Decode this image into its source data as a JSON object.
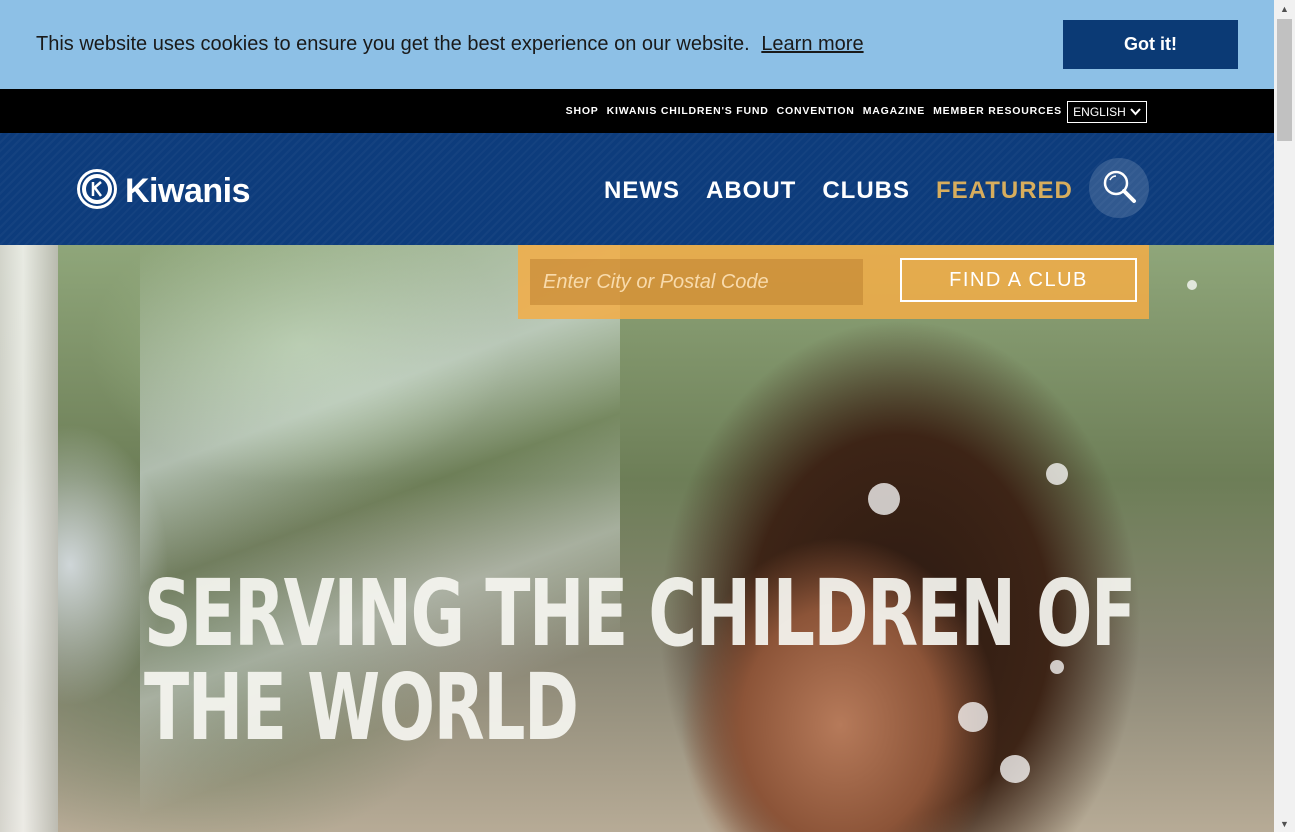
{
  "cookie": {
    "message": "This website uses cookies to ensure you get the best experience on our website.",
    "learn_more": "Learn more",
    "accept": "Got it!"
  },
  "utility": {
    "links": [
      "SHOP",
      "KIWANIS CHILDREN'S FUND",
      "CONVENTION",
      "MAGAZINE",
      "MEMBER RESOURCES"
    ],
    "language": "ENGLISH"
  },
  "header": {
    "logo_text": "Kiwanis",
    "nav": [
      "NEWS",
      "ABOUT",
      "CLUBS",
      "FEATURED"
    ],
    "search_icon": "search-icon"
  },
  "find_club": {
    "placeholder": "Enter City or Postal Code",
    "button": "FIND A CLUB"
  },
  "hero": {
    "title_line1": "SERVING THE CHILDREN OF",
    "title_line2": "THE WORLD"
  },
  "colors": {
    "cookie_bg": "#8dc0e6",
    "cookie_button": "#0b3a75",
    "header_bg": "#0d3c7c",
    "featured": "#d7ad5d",
    "find_bar": "#f3ad46"
  }
}
